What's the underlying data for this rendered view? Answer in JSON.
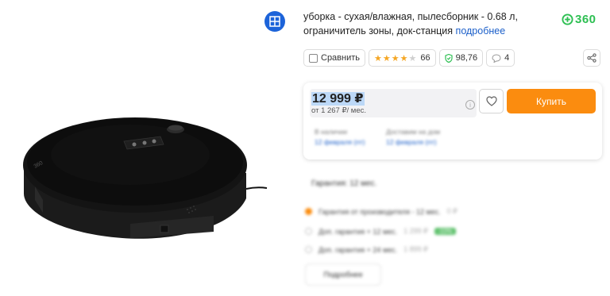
{
  "description": {
    "text": "уборка - сухая/влажная, пылесборник - 0.68 л, ограничитель зоны, док-станция",
    "more_link": "подробнее"
  },
  "brand": {
    "name": "360"
  },
  "actions": {
    "compare_label": "Сравнить",
    "rating": {
      "stars": 4,
      "max": 5,
      "reviews": "66"
    },
    "reliability": "98,76",
    "questions": "4"
  },
  "price_card": {
    "price": "12 999 ₽",
    "installment": "от 1 267 ₽/ мес.",
    "buy_label": "Купить",
    "availability": [
      {
        "line1": "В наличии",
        "line2": "12 февраля (пт)"
      },
      {
        "line1": "Доставим на дом",
        "line2": "12 февраля (пт)"
      }
    ]
  },
  "warranty": {
    "title": "Гарантия: 12 мес.",
    "options": [
      {
        "label": "Гарантия от производителя - 12 мес.",
        "price": "0 ₽",
        "badge": "",
        "selected": true
      },
      {
        "label": "Доп. гарантия  + 12 мес.",
        "price": "1 299 ₽",
        "badge": "-10%",
        "selected": false
      },
      {
        "label": "Доп. гарантия  + 24 мес.",
        "price": "1 899 ₽",
        "badge": "",
        "selected": false
      }
    ],
    "details_label": "Подробнее"
  },
  "colors": {
    "accent": "#fb8c0f",
    "link": "#1b5fc9",
    "brand": "#2dbf52",
    "icon_bg": "#1c63d9"
  }
}
